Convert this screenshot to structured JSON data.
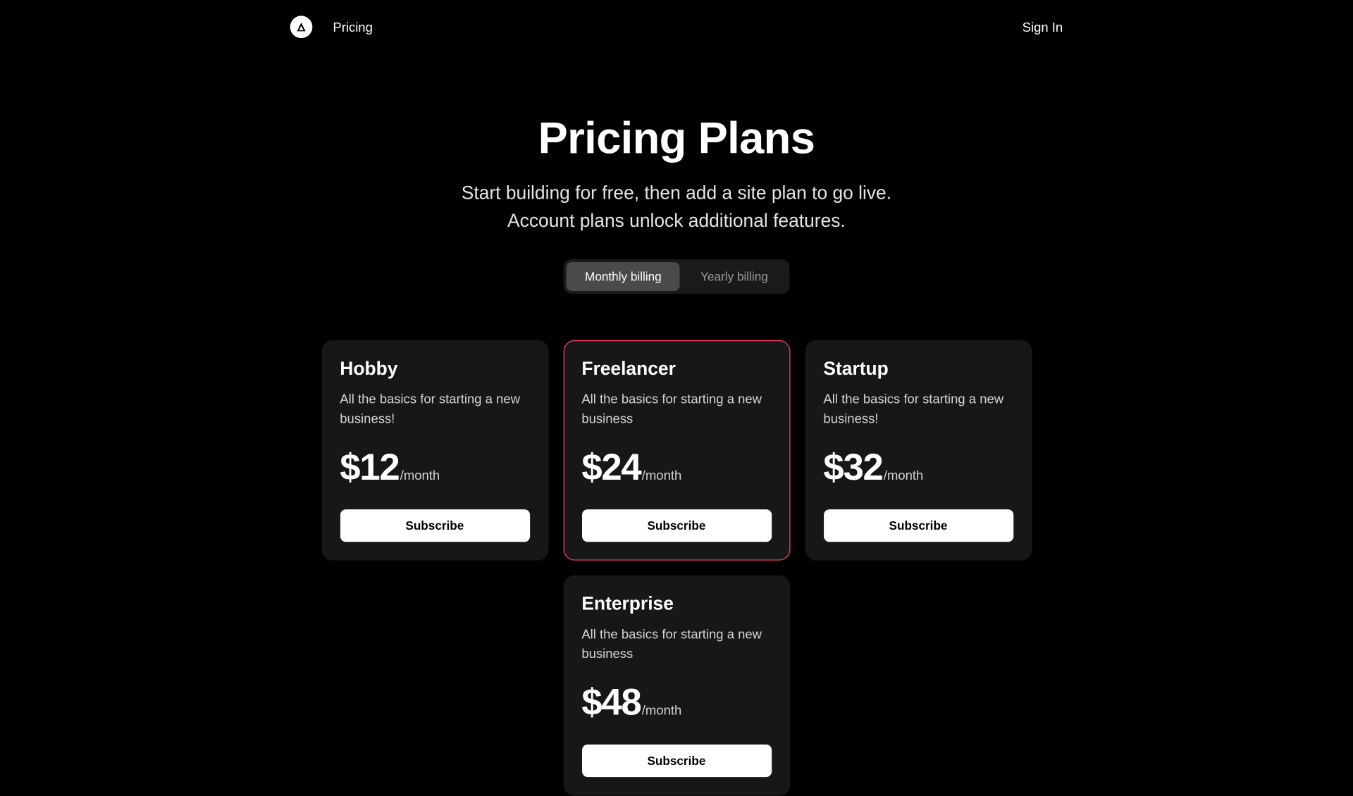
{
  "nav": {
    "pricing_label": "Pricing",
    "signin_label": "Sign In"
  },
  "hero": {
    "title": "Pricing Plans",
    "subtitle": "Start building for free, then add a site plan to go live. Account plans unlock additional features."
  },
  "billing_toggle": {
    "monthly": "Monthly billing",
    "yearly": "Yearly billing"
  },
  "plans": [
    {
      "name": "Hobby",
      "description": "All the basics for starting a new business!",
      "price": "$12",
      "period": "/month",
      "cta": "Subscribe",
      "highlighted": false
    },
    {
      "name": "Freelancer",
      "description": "All the basics for starting a new business",
      "price": "$24",
      "period": "/month",
      "cta": "Subscribe",
      "highlighted": true
    },
    {
      "name": "Startup",
      "description": "All the basics for starting a new business!",
      "price": "$32",
      "period": "/month",
      "cta": "Subscribe",
      "highlighted": false
    },
    {
      "name": "Enterprise",
      "description": "All the basics for starting a new business",
      "price": "$48",
      "period": "/month",
      "cta": "Subscribe",
      "highlighted": false
    }
  ]
}
